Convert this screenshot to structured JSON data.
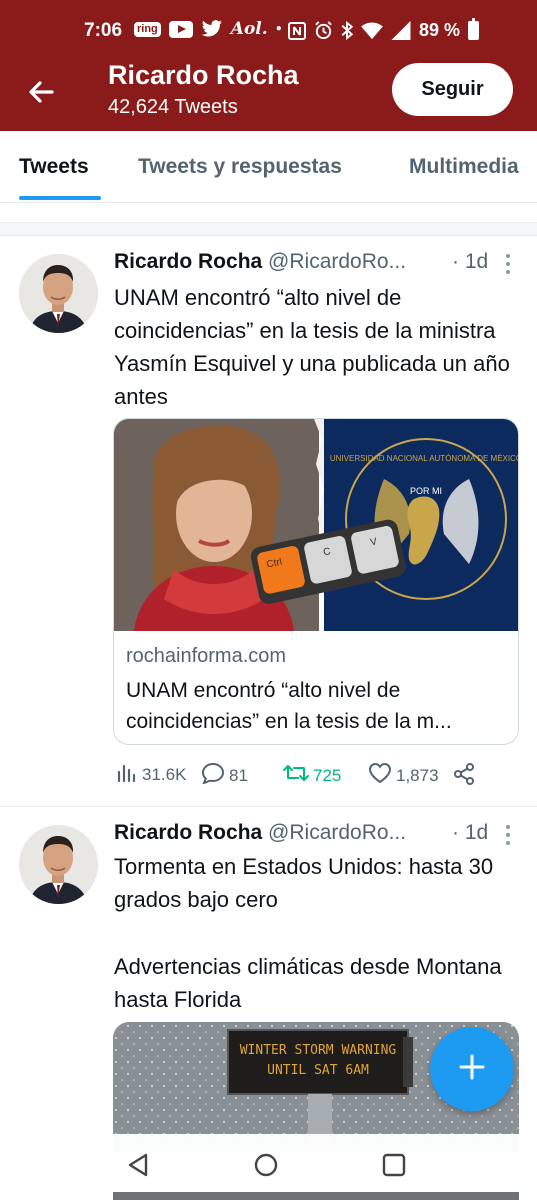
{
  "status_bar": {
    "time": "7:06",
    "ring_label": "ring",
    "aol_label": "Aol.",
    "battery_pct": "89 %"
  },
  "header": {
    "name": "Ricardo Rocha",
    "tweet_count": "42,624 Tweets",
    "follow_label": "Seguir",
    "bg_color": "#8b1a1a"
  },
  "tabs": [
    {
      "label": "Tweets",
      "active": true
    },
    {
      "label": "Tweets y respuestas",
      "active": false
    },
    {
      "label": "Multimedia",
      "active": false
    }
  ],
  "tweets": [
    {
      "name": "Ricardo Rocha",
      "handle": "@RicardoRo...",
      "time": "· 1d",
      "text": "UNAM encontró “alto nivel de coincidencias” en la tesis de la ministra Yasmín Esquivel y una publicada un año antes",
      "card": {
        "domain": "rochainforma.com",
        "title": "UNAM encontró “alto nivel de coincidencias” en la tesis de la m...",
        "keys": [
          "Ctrl",
          "C",
          "V"
        ],
        "emblem_text": "UNIVERSIDAD NACIONAL AUTÓNOMA DE MÉXICO",
        "emblem_motto": "POR MI"
      },
      "stats": {
        "views": "31.6K",
        "replies": "81",
        "retweets": "725",
        "likes": "1,873"
      }
    },
    {
      "name": "Ricardo Rocha",
      "handle": "@RicardoRo...",
      "time": "· 1d",
      "text_line1": "Tormenta en Estados Unidos: hasta 30 grados bajo cero",
      "text_line2": "Advertencias climáticas desde Montana hasta Florida",
      "sign_line1": "WINTER STORM WARNING",
      "sign_line2": "UNTIL SAT 6AM"
    }
  ],
  "colors": {
    "accent": "#1d9bf0",
    "retweet_green": "#00ba7c",
    "secondary_text": "#536471"
  }
}
